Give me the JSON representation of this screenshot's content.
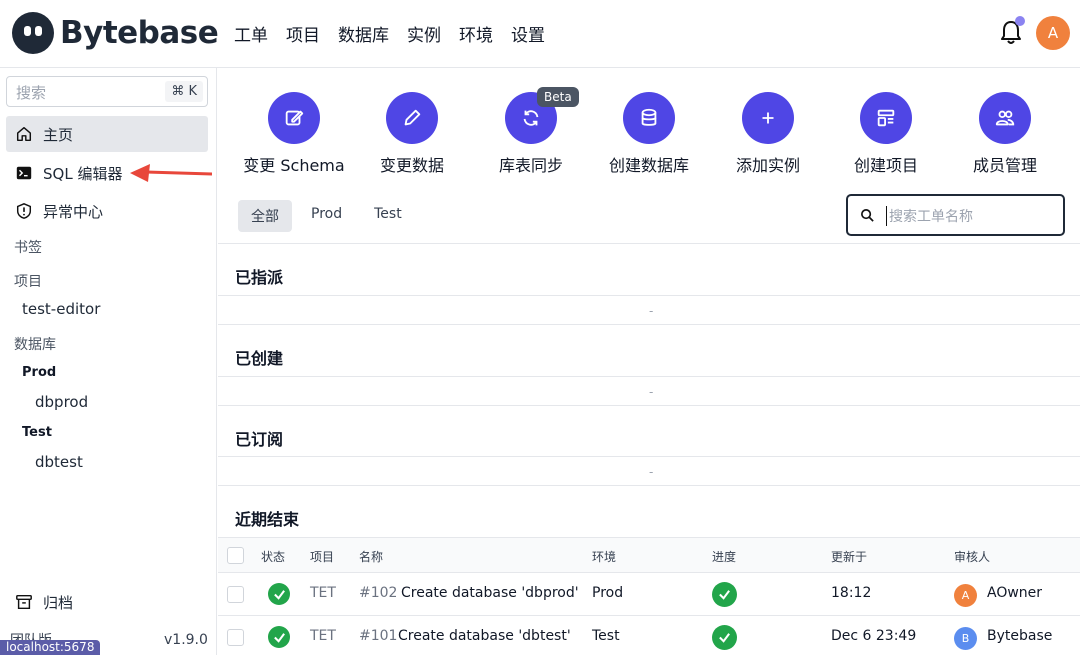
{
  "app": {
    "brand": "Bytebase"
  },
  "topnav": [
    "工单",
    "项目",
    "数据库",
    "实例",
    "环境",
    "设置"
  ],
  "user": {
    "initial": "A",
    "avatar_color": "#f0813d"
  },
  "sidebar": {
    "search_placeholder": "搜索",
    "shortcut": "⌘ K",
    "items": [
      {
        "label": "主页",
        "icon": "home-icon",
        "active": true
      },
      {
        "label": "SQL 编辑器",
        "icon": "terminal-icon"
      },
      {
        "label": "异常中心",
        "icon": "shield-icon"
      }
    ],
    "bookmarks_title": "书签",
    "projects_title": "项目",
    "projects": [
      "test-editor"
    ],
    "databases_title": "数据库",
    "envs": [
      {
        "name": "Prod",
        "dbs": [
          "dbprod"
        ]
      },
      {
        "name": "Test",
        "dbs": [
          "dbtest"
        ]
      }
    ],
    "archive": "归档",
    "edition": "团队版",
    "version": "v1.9.0",
    "status_url": "localhost:5678"
  },
  "actions": [
    {
      "label": "变更 Schema",
      "icon": "edit-schema-icon"
    },
    {
      "label": "变更数据",
      "icon": "pencil-icon"
    },
    {
      "label": "库表同步",
      "icon": "sync-icon",
      "badge": "Beta"
    },
    {
      "label": "创建数据库",
      "icon": "database-icon"
    },
    {
      "label": "添加实例",
      "icon": "plus-icon"
    },
    {
      "label": "创建项目",
      "icon": "template-icon"
    },
    {
      "label": "成员管理",
      "icon": "users-icon"
    }
  ],
  "env_tabs": [
    "全部",
    "Prod",
    "Test"
  ],
  "issue_search_placeholder": "搜索工单名称",
  "sections": {
    "assigned": "已指派",
    "created": "已创建",
    "subscribed": "已订阅",
    "recent": "近期结束",
    "empty": "-"
  },
  "table": {
    "headers": [
      "状态",
      "项目",
      "名称",
      "环境",
      "进度",
      "更新于",
      "审核人"
    ],
    "rows": [
      {
        "project": "TET",
        "id": "#102",
        "name": "Create database 'dbprod'",
        "env": "Prod",
        "updated": "18:12",
        "reviewer": "AOwner",
        "reviewer_initial": "A",
        "reviewer_color": "#f0813d"
      },
      {
        "project": "TET",
        "id": "#101",
        "name": "Create database 'dbtest'",
        "env": "Test",
        "updated": "Dec 6 23:49",
        "reviewer": "Bytebase",
        "reviewer_initial": "B",
        "reviewer_color": "#5b8def"
      }
    ]
  },
  "colors": {
    "accent": "#4f46e5",
    "success": "#22a54a",
    "arrow": "#e8473b"
  }
}
